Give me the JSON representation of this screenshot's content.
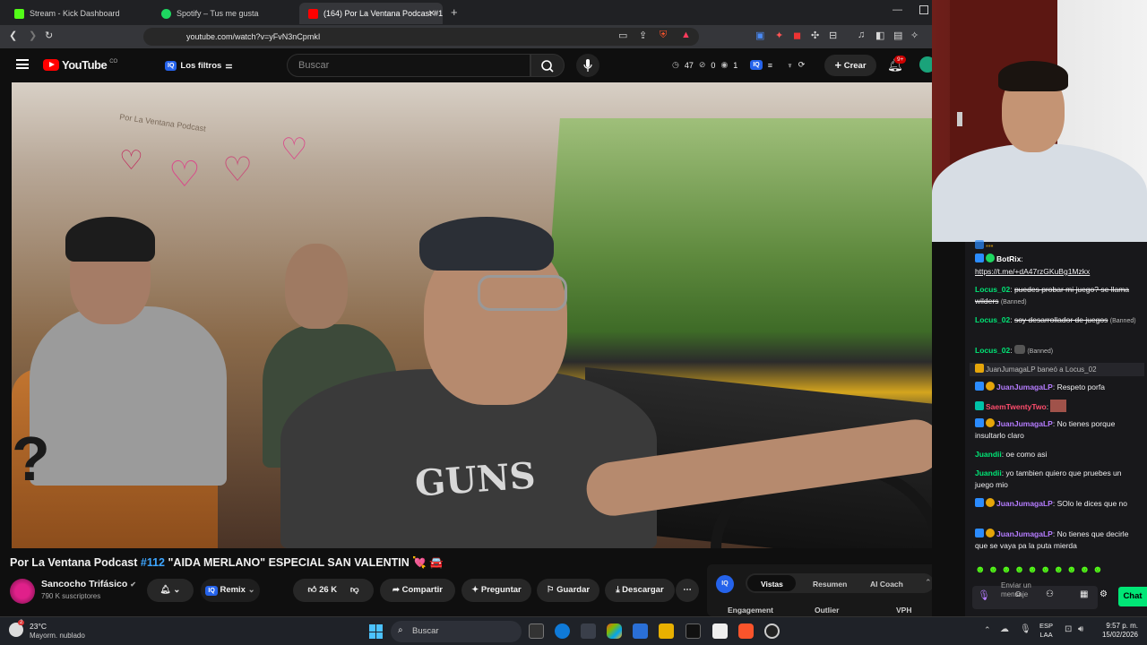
{
  "browser": {
    "tabs": [
      {
        "title": "Stream - Kick Dashboard",
        "active": false,
        "favicon_color": "#53fc18"
      },
      {
        "title": "Spotify – Tus me gusta",
        "active": false,
        "favicon_color": "#1ed760"
      },
      {
        "title": "(164) Por La Ventana Podcast #1",
        "active": true,
        "favicon_color": "#ff0000"
      }
    ],
    "new_tab": "+",
    "url": "youtube.com/watch?v=yFvN3nCpmkI",
    "brave_badge": "1"
  },
  "youtube": {
    "logo_text": "YouTube",
    "region": "CO",
    "filters_label": "Los filtros",
    "search_placeholder": "Buscar",
    "stats": {
      "notif_count": "47",
      "zero_count": "0",
      "one_count": "1"
    },
    "create_label": "Crear",
    "bell_badge": "9+"
  },
  "video": {
    "title_prefix": "Por La Ventana Podcast ",
    "title_tag": "#112",
    "title_rest": " \"AIDA MERLANO\" ESPECIAL SAN VALENTIN 💘 🚘",
    "watermark": "Por La Ventana Podcast"
  },
  "channel": {
    "name": "Sancocho Trifásico",
    "verified": "✔",
    "subscribers": "790 K suscriptores",
    "remix_label": "Remix",
    "likes": "26 K",
    "share_label": "Compartir",
    "ask_label": "Preguntar",
    "save_label": "Guardar",
    "download_label": "Descargar",
    "more_label": "⋯"
  },
  "iq_panel": {
    "badge": "IQ",
    "tabs": [
      "Vistas",
      "Resumen",
      "AI Coach"
    ],
    "columns": [
      "Engagement",
      "Outlier",
      "VPH"
    ]
  },
  "chat": {
    "messages": [
      {
        "user": "BotRix",
        "text": "",
        "color": "#00ff7f"
      },
      {
        "user": "",
        "text": "https://t.me/+dA47rzGKuBg1Mzkx",
        "color": "#ffffff"
      },
      {
        "user": "Locus_02",
        "text": "puedes probar mi juego? se llama wilders",
        "suffix": "(Banned)",
        "color": "#00e676"
      },
      {
        "user": "Locus_02",
        "text": "soy desarrollador de juegos",
        "suffix": "(Banned)",
        "color": "#00e676"
      },
      {
        "user": "Locus_02",
        "text": "",
        "suffix": "(Banned)",
        "color": "#00e676"
      },
      {
        "user": "JuanJumagaLP",
        "text": "baneó a Locus_02",
        "color": "#bbbbbb"
      },
      {
        "user": "JuanJumagaLP",
        "text": "Respeto porfa",
        "color": "#b57cff"
      },
      {
        "user": "SaemTwentyTwo",
        "text": "",
        "color": "#ff4d6d"
      },
      {
        "user": "JuanJumagaLP",
        "text": "No tienes porque insultarlo claro",
        "color": "#b57cff"
      },
      {
        "user": "Juandii",
        "text": "oe como asi",
        "color": "#00e676"
      },
      {
        "user": "Juandii",
        "text": "yo tambien quiero que pruebes un juego mio",
        "color": "#00e676"
      },
      {
        "user": "JuanJumagaLP",
        "text": "SOlo le dices que no",
        "color": "#b57cff"
      },
      {
        "user": "JuanJumagaLP",
        "text": "No tienes que decirle que se vaya pa la puta mierda",
        "color": "#b57cff"
      }
    ],
    "input_placeholder": "Enviar un mensaje",
    "send_label": "Chat"
  },
  "taskbar": {
    "weather_temp": "23°C",
    "weather_desc": "Mayorm. nublado",
    "weather_badge": "2",
    "search_label": "Buscar",
    "lang_top": "ESP",
    "lang_bottom": "LAA",
    "time": "9:57 p. m.",
    "date": "15/02/2026"
  }
}
